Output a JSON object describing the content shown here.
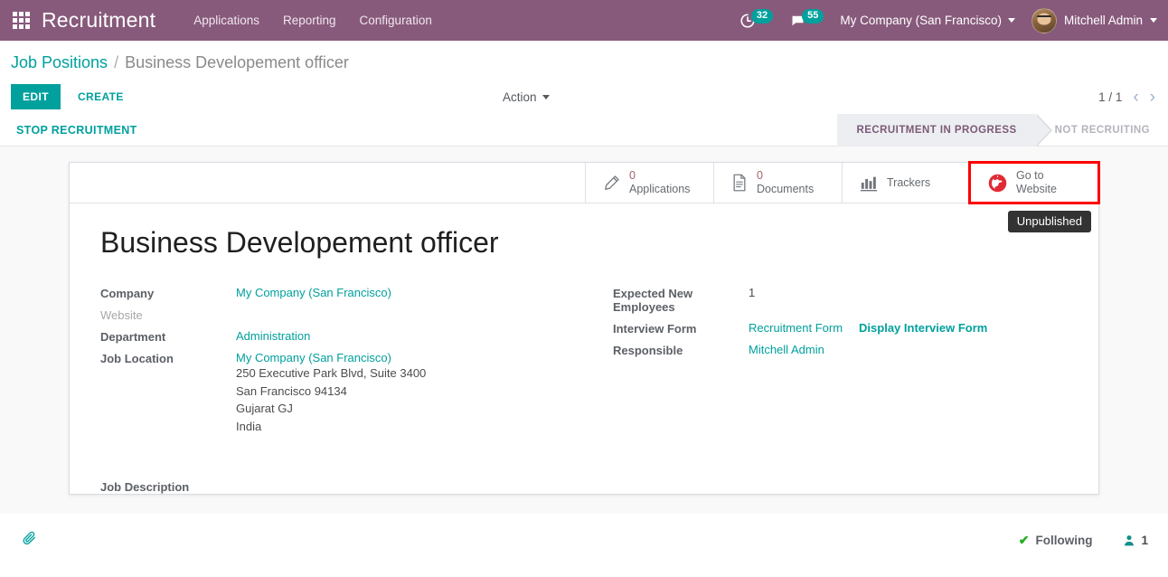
{
  "navbar": {
    "apps_icon": "apps-grid-icon",
    "brand": "Recruitment",
    "menu": [
      {
        "label": "Applications"
      },
      {
        "label": "Reporting"
      },
      {
        "label": "Configuration"
      }
    ],
    "activities": {
      "icon": "clock-icon",
      "count": "32"
    },
    "messages": {
      "icon": "chat-bubble-icon",
      "count": "55"
    },
    "company": "My Company (San Francisco)",
    "user": "Mitchell Admin",
    "bg_color": "#875a7b",
    "badge_color": "#00a09d"
  },
  "breadcrumb": {
    "parent": "Job Positions",
    "separator": "/",
    "current": "Business Developement officer"
  },
  "control_panel": {
    "edit_label": "EDIT",
    "create_label": "CREATE",
    "action_label": "Action",
    "pager_text": "1 / 1",
    "prev_icon": "chevron-left-icon",
    "next_icon": "chevron-right-icon",
    "accent_color": "#00a09d"
  },
  "statusbar": {
    "stop_label": "STOP RECRUITMENT",
    "steps": [
      {
        "label": "RECRUITMENT IN PROGRESS",
        "active": true
      },
      {
        "label": "NOT RECRUITING",
        "active": false
      }
    ]
  },
  "stat_buttons": [
    {
      "icon": "pencil-icon",
      "value": "0",
      "label": "Applications"
    },
    {
      "icon": "document-icon",
      "value": "0",
      "label": "Documents"
    },
    {
      "icon": "bar-chart-icon",
      "value": "",
      "label": "Trackers"
    },
    {
      "icon": "globe-icon",
      "line1": "Go to",
      "line2": "Website",
      "highlighted": true,
      "highlight_color": "#fc0000"
    }
  ],
  "tooltip": {
    "text": "Unpublished"
  },
  "form": {
    "title": "Business Developement officer",
    "left": {
      "company_label": "Company",
      "company_value": "My Company (San Francisco)",
      "website_label": "Website",
      "website_value": "",
      "department_label": "Department",
      "department_value": "Administration",
      "job_location_label": "Job Location",
      "job_location_value": "My Company (San Francisco)",
      "address_lines": [
        "250 Executive Park Blvd, Suite 3400",
        "San Francisco 94134",
        "Gujarat GJ",
        "India"
      ]
    },
    "right": {
      "expected_label_1": "Expected New",
      "expected_label_2": "Employees",
      "expected_value": "1",
      "interview_form_label": "Interview Form",
      "interview_form_value": "Recruitment Form",
      "display_interview_form": "Display Interview Form",
      "responsible_label": "Responsible",
      "responsible_value": "Mitchell Admin"
    },
    "job_description_label": "Job Description"
  },
  "chatter": {
    "attachment_icon": "paperclip-icon",
    "following_label": "Following",
    "following_icon": "check-icon",
    "followers_icon": "user-icon",
    "followers_count": "1"
  }
}
